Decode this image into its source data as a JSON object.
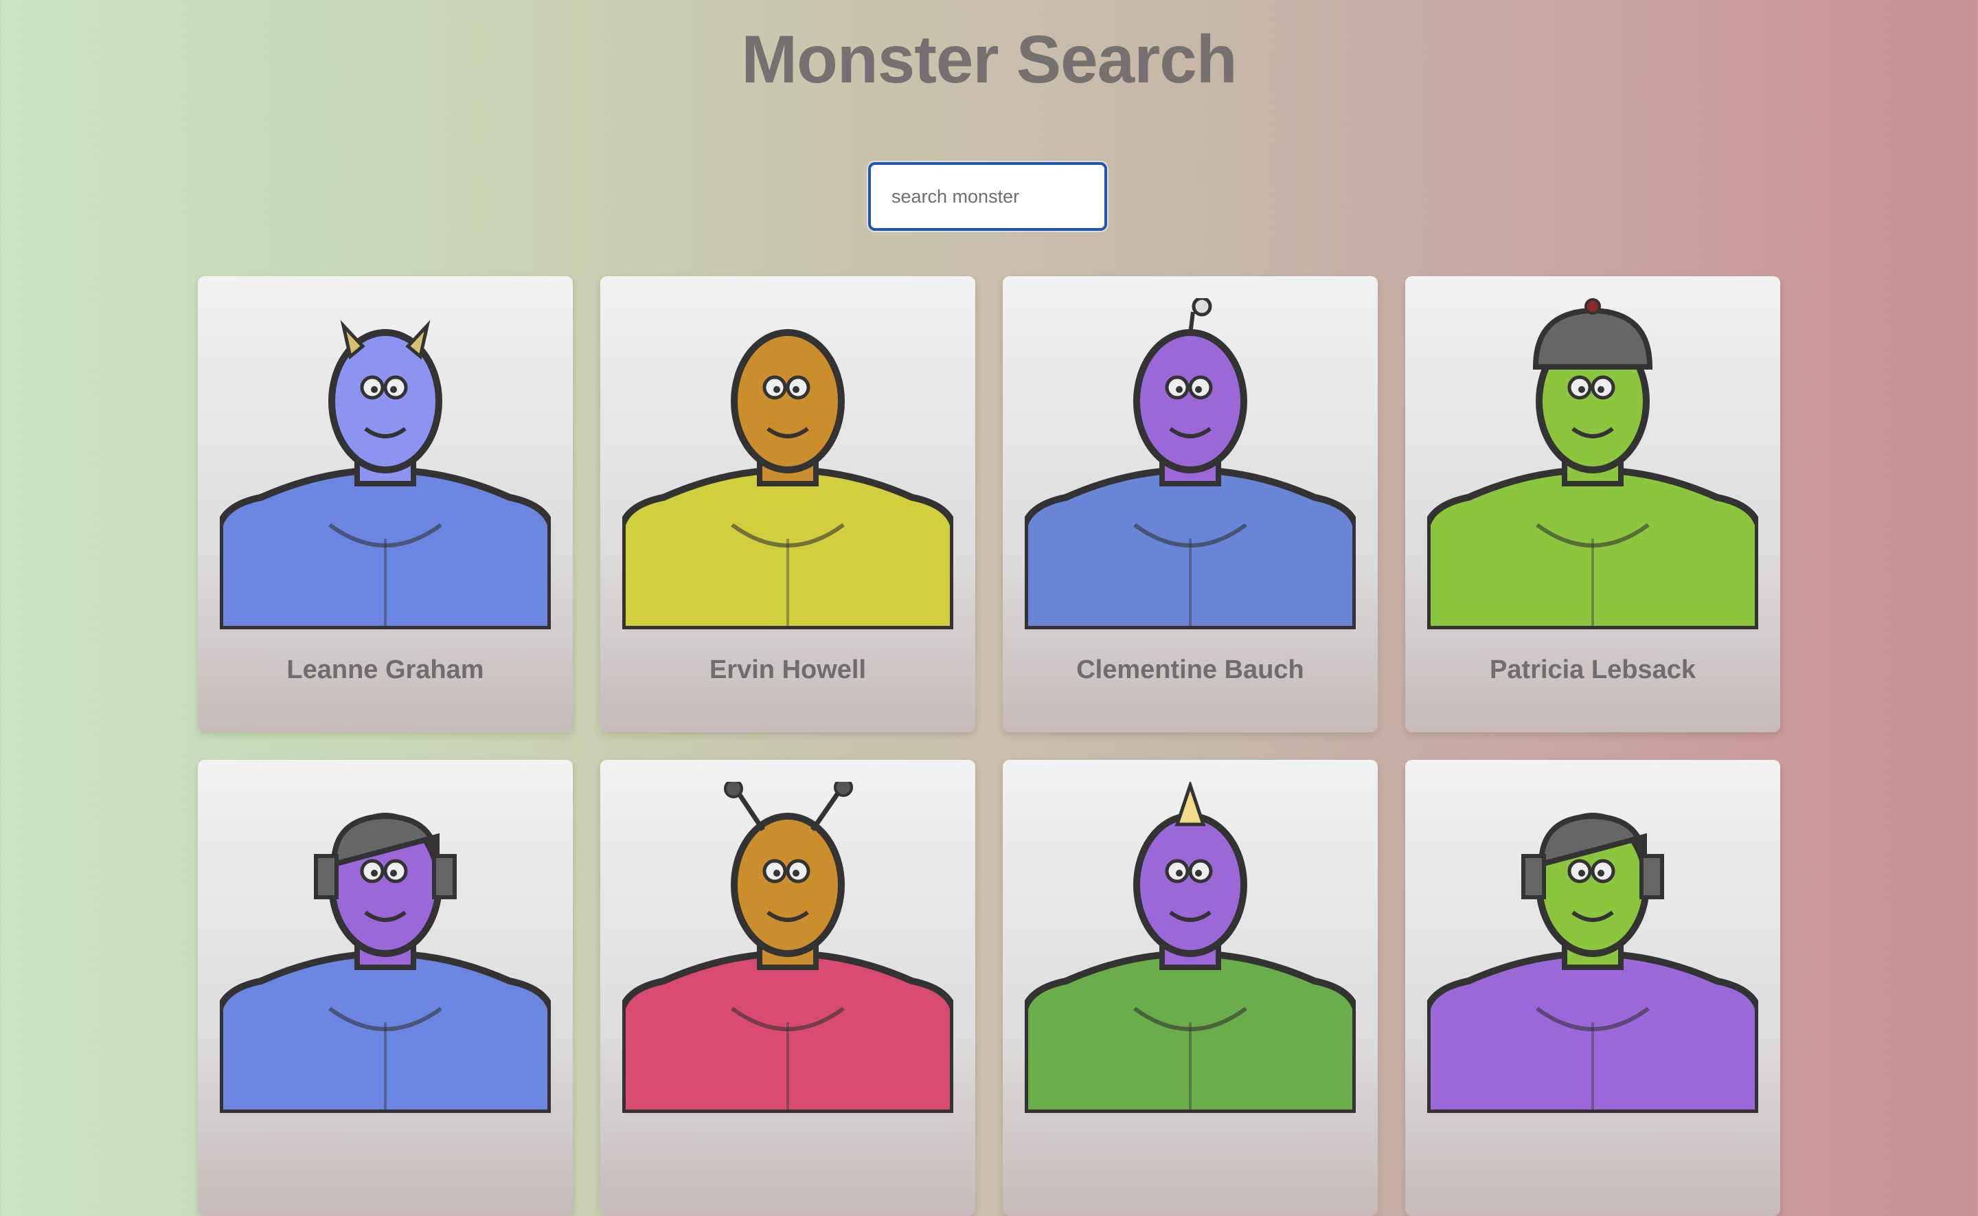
{
  "page": {
    "title": "Monster Search"
  },
  "search": {
    "placeholder": "search monster",
    "value": ""
  },
  "monsters": [
    {
      "name": "Leanne Graham",
      "body_color": "#6b86e0",
      "head_color": "#8b94f0",
      "accent": "horns"
    },
    {
      "name": "Ervin Howell",
      "body_color": "#d2cf3e",
      "head_color": "#cc8e2c",
      "accent": "spiky"
    },
    {
      "name": "Clementine Bauch",
      "body_color": "#6885d8",
      "head_color": "#9a68d8",
      "accent": "antenna"
    },
    {
      "name": "Patricia Lebsack",
      "body_color": "#8cc63e",
      "head_color": "#8cc63e",
      "accent": "helmet"
    },
    {
      "name": "",
      "body_color": "#6b86e0",
      "head_color": "#9a68d8",
      "accent": "robot"
    },
    {
      "name": "",
      "body_color": "#d94a70",
      "head_color": "#cc8e2c",
      "accent": "antennae"
    },
    {
      "name": "",
      "body_color": "#6aad4a",
      "head_color": "#9a68d8",
      "accent": "horn"
    },
    {
      "name": "",
      "body_color": "#9a68d8",
      "head_color": "#8cc63e",
      "accent": "robot"
    }
  ]
}
